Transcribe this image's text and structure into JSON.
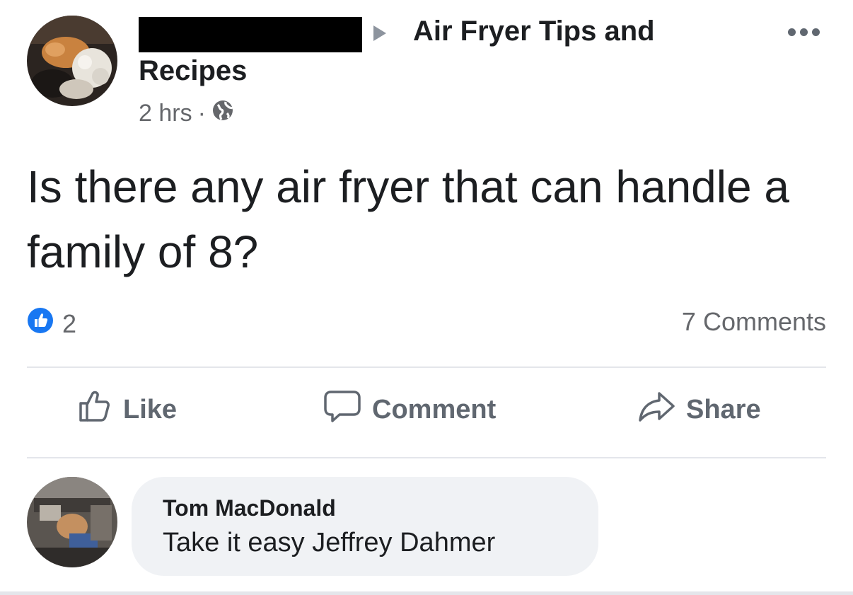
{
  "post": {
    "group_name_line1": "Air Fryer Tips and",
    "group_name_line2": "Recipes",
    "timestamp": "2 hrs",
    "meta_separator": "·",
    "privacy_icon": "globe-icon",
    "more_icon": "more-options-icon",
    "text": "Is there any air fryer that can handle a family of 8?",
    "like_count": "2",
    "comments_count": "7 Comments"
  },
  "actions": {
    "like_label": "Like",
    "comment_label": "Comment",
    "share_label": "Share"
  },
  "comment": {
    "author": "Tom MacDonald",
    "text": "Take it easy Jeffrey Dahmer"
  },
  "colors": {
    "reaction_blue": "#1877f2",
    "secondary_text": "#65676b",
    "bubble_bg": "#f0f2f5",
    "divider": "#e4e6eb"
  }
}
